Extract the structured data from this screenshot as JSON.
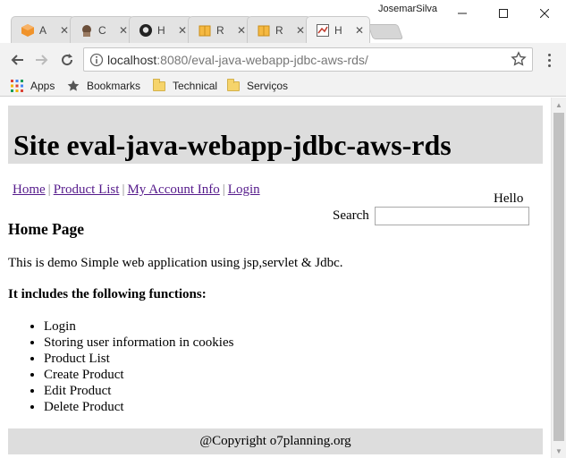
{
  "window": {
    "user_name": "JosemarSilva",
    "minimize_glyph": "—",
    "maximize_glyph": "☐",
    "close_glyph": "✕"
  },
  "tabs": [
    {
      "title": "A",
      "icon": "aws-cube-icon",
      "active": false
    },
    {
      "title": "C",
      "icon": "octocat-icon",
      "active": false
    },
    {
      "title": "H",
      "icon": "github-icon",
      "active": false
    },
    {
      "title": "R",
      "icon": "box-icon",
      "active": false
    },
    {
      "title": "R",
      "icon": "box-icon",
      "active": false
    },
    {
      "title": "H",
      "icon": "page-icon",
      "active": true
    }
  ],
  "toolbar": {
    "url_host": "localhost",
    "url_path": ":8080/eval-java-webapp-jdbc-aws-rds/"
  },
  "bookmarks": {
    "items": [
      {
        "label": "Apps",
        "icon": "apps-grid-icon"
      },
      {
        "label": "Bookmarks",
        "icon": "star-icon"
      },
      {
        "label": "Technical",
        "icon": "folder-icon"
      },
      {
        "label": "Serviços",
        "icon": "folder-icon"
      }
    ]
  },
  "page": {
    "site_title": "Site eval-java-webapp-jdbc-aws-rds",
    "nav": {
      "home": "Home",
      "product_list": "Product List",
      "my_account_info": "My Account Info",
      "login": "Login",
      "separator": "|"
    },
    "hello": "Hello",
    "search_label": "Search",
    "search_value": "",
    "heading": "Home Page",
    "intro": "This is demo Simple web application using jsp,servlet & Jdbc.",
    "functions_heading": "It includes the following functions:",
    "functions": [
      "Login",
      "Storing user information in cookies",
      "Product List",
      "Create Product",
      "Edit Product",
      "Delete Product"
    ],
    "footer": "@Copyright o7planning.org"
  },
  "colors": {
    "header_bg": "#dddddd",
    "link_visited": "#551a8b",
    "chrome_bg": "#f2f2f2"
  }
}
